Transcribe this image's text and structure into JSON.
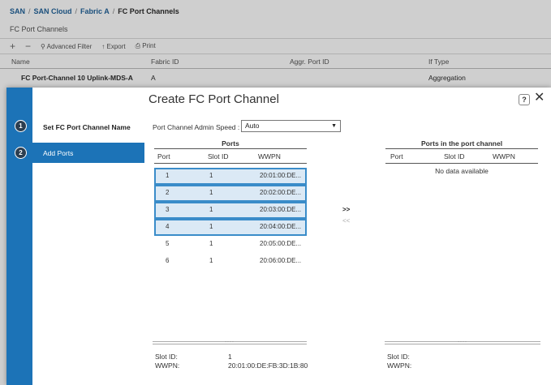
{
  "breadcrumb": {
    "items": [
      "SAN",
      "SAN Cloud",
      "Fabric A"
    ],
    "current": "FC Port Channels",
    "sep": "/"
  },
  "bg": {
    "title": "FC Port Channels",
    "toolbar": {
      "add": "+",
      "remove": "−",
      "filter": "Advanced Filter",
      "export": "Export",
      "print": "Print"
    },
    "columns": [
      "Name",
      "Fabric ID",
      "Aggr. Port ID",
      "If Type"
    ],
    "row": {
      "name": "FC Port-Channel 10 Uplink-MDS-A",
      "fabric": "A",
      "aggr": "",
      "iftype": "Aggregation"
    }
  },
  "dialog": {
    "title": "Create FC Port Channel",
    "help": "?",
    "close": "✕",
    "steps": [
      {
        "num": "1",
        "label": "Set FC Port Channel Name"
      },
      {
        "num": "2",
        "label": "Add Ports"
      }
    ],
    "speed": {
      "label": "Port Channel Admin Speed :",
      "value": "Auto"
    },
    "ports": {
      "title": "Ports",
      "columns": [
        "Port",
        "Slot ID",
        "WWPN"
      ],
      "rows": [
        {
          "port": "1",
          "slot": "1",
          "wwpn": "20:01:00:DE...",
          "selected": true
        },
        {
          "port": "2",
          "slot": "1",
          "wwpn": "20:02:00:DE...",
          "selected": true
        },
        {
          "port": "3",
          "slot": "1",
          "wwpn": "20:03:00:DE...",
          "selected": true
        },
        {
          "port": "4",
          "slot": "1",
          "wwpn": "20:04:00:DE...",
          "selected": true
        },
        {
          "port": "5",
          "slot": "1",
          "wwpn": "20:05:00:DE...",
          "selected": false
        },
        {
          "port": "6",
          "slot": "1",
          "wwpn": "20:06:00:DE...",
          "selected": false
        }
      ]
    },
    "move_right": ">>",
    "move_left": "<<",
    "channel": {
      "title": "Ports in the port channel",
      "columns": [
        "Port",
        "Slot ID",
        "WWPN"
      ],
      "empty": "No data available"
    },
    "splitter_dots": "....",
    "details_left": {
      "slot_label": "Slot ID:",
      "slot_value": "1",
      "wwpn_label": "WWPN:",
      "wwpn_value": "20:01:00:DE:FB:3D:1B:80"
    },
    "details_right": {
      "slot_label": "Slot ID:",
      "wwpn_label": "WWPN:"
    }
  }
}
